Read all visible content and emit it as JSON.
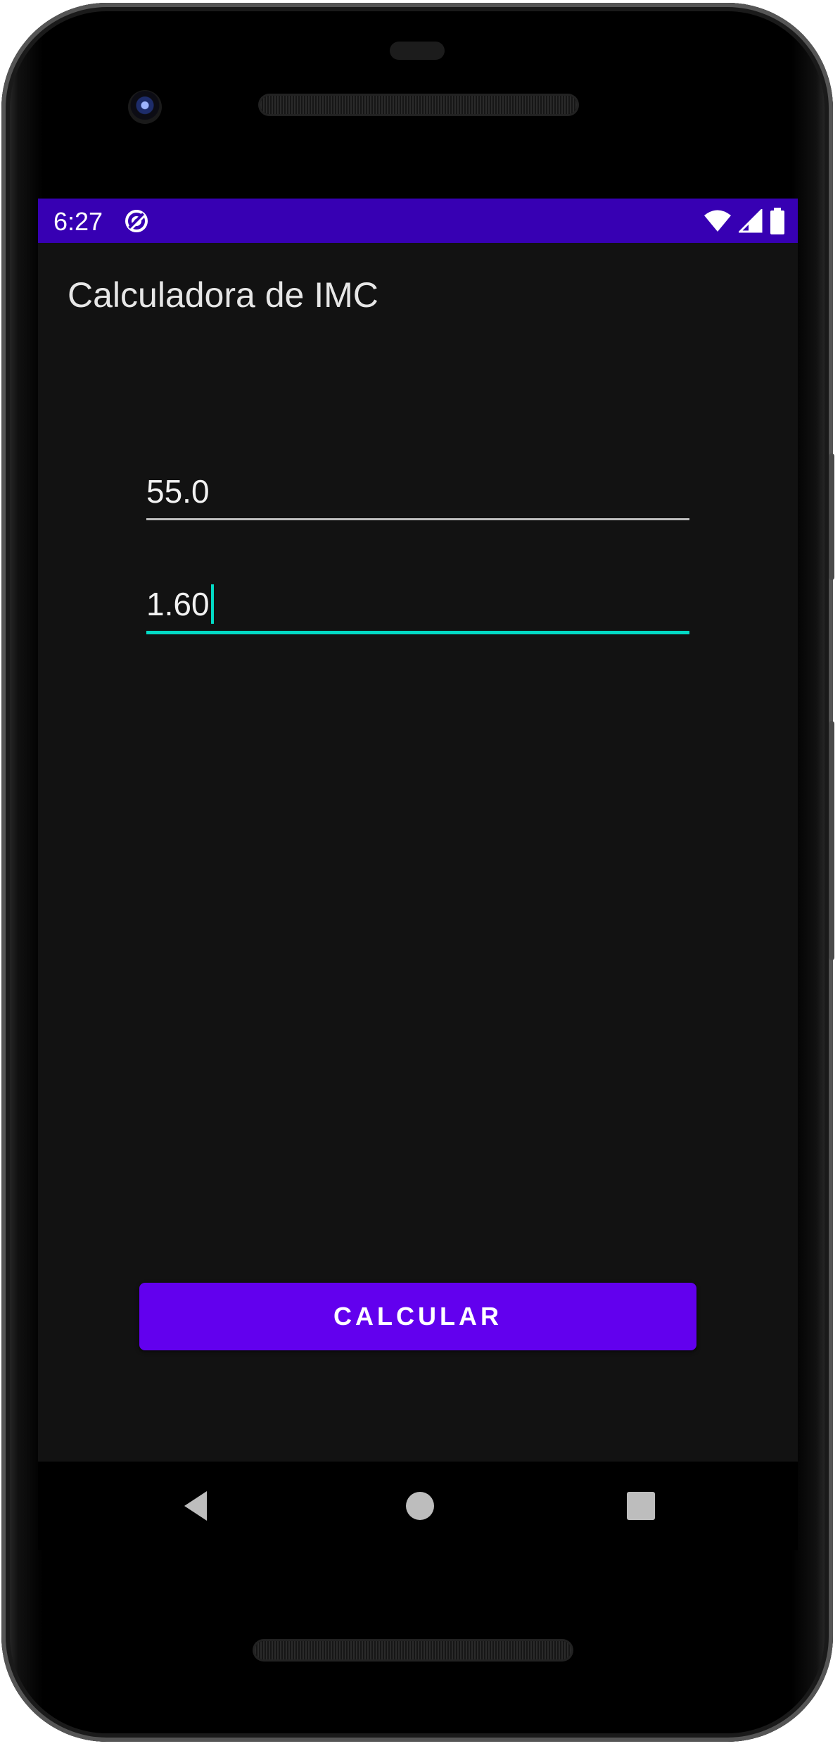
{
  "status_bar": {
    "time": "6:27",
    "app_icon": "at-sign-icon",
    "icons": [
      "wifi-icon",
      "cell-signal-icon",
      "battery-icon"
    ],
    "background_color": "#3700b3"
  },
  "app": {
    "title": "Calculadora de IMC",
    "background_color": "#121212"
  },
  "form": {
    "weight": {
      "value": "55.0"
    },
    "height": {
      "value": "1.60",
      "focused": true
    },
    "accent_color": "#03dac5"
  },
  "button": {
    "label": "CALCULAR",
    "color": "#6200ee"
  },
  "navigation": {
    "items": [
      "back-icon",
      "home-icon",
      "recents-icon"
    ]
  }
}
